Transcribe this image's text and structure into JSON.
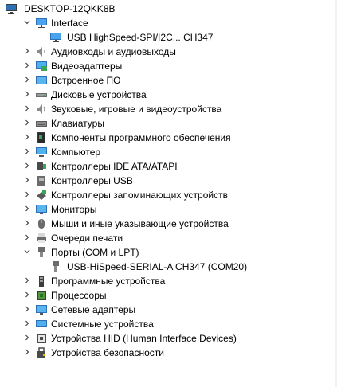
{
  "root": {
    "label": "DESKTOP-12QKK8B",
    "icon": "computer-icon"
  },
  "categories": [
    {
      "label": "Interface",
      "icon": "monitor-icon",
      "expanded": true,
      "children": [
        {
          "label": "USB HighSpeed-SPI/I2C... CH347",
          "icon": "monitor-icon"
        }
      ]
    },
    {
      "label": "Аудиовходы и аудиовыходы",
      "icon": "speaker-icon"
    },
    {
      "label": "Видеоадаптеры",
      "icon": "display-adapter-icon"
    },
    {
      "label": "Встроенное ПО",
      "icon": "firmware-icon"
    },
    {
      "label": "Дисковые устройства",
      "icon": "disk-drive-icon"
    },
    {
      "label": "Звуковые, игровые и видеоустройства",
      "icon": "sound-icon"
    },
    {
      "label": "Клавиатуры",
      "icon": "keyboard-icon"
    },
    {
      "label": "Компоненты программного обеспечения",
      "icon": "software-component-icon"
    },
    {
      "label": "Компьютер",
      "icon": "computer-monitor-icon"
    },
    {
      "label": "Контроллеры IDE ATA/ATAPI",
      "icon": "ide-controller-icon"
    },
    {
      "label": "Контроллеры USB",
      "icon": "usb-controller-icon"
    },
    {
      "label": "Контроллеры запоминающих устройств",
      "icon": "storage-controller-icon"
    },
    {
      "label": "Мониторы",
      "icon": "monitor-icon"
    },
    {
      "label": "Мыши и иные указывающие устройства",
      "icon": "mouse-icon"
    },
    {
      "label": "Очереди печати",
      "icon": "printer-icon"
    },
    {
      "label": "Порты (COM и LPT)",
      "icon": "port-icon",
      "expanded": true,
      "children": [
        {
          "label": "USB-HiSpeed-SERIAL-A CH347 (COM20)",
          "icon": "port-icon"
        }
      ]
    },
    {
      "label": "Программные устройства",
      "icon": "software-device-icon"
    },
    {
      "label": "Процессоры",
      "icon": "processor-icon"
    },
    {
      "label": "Сетевые адаптеры",
      "icon": "network-adapter-icon"
    },
    {
      "label": "Системные устройства",
      "icon": "system-device-icon"
    },
    {
      "label": "Устройства HID (Human Interface Devices)",
      "icon": "hid-icon"
    },
    {
      "label": "Устройства безопасности",
      "icon": "security-device-icon"
    }
  ],
  "colors": {
    "monitor_blue": "#1e88d6",
    "monitor_frame": "#2f6fb6",
    "gray": "#7a7a7a",
    "dark": "#3b3b3b",
    "green": "#3aa655"
  }
}
